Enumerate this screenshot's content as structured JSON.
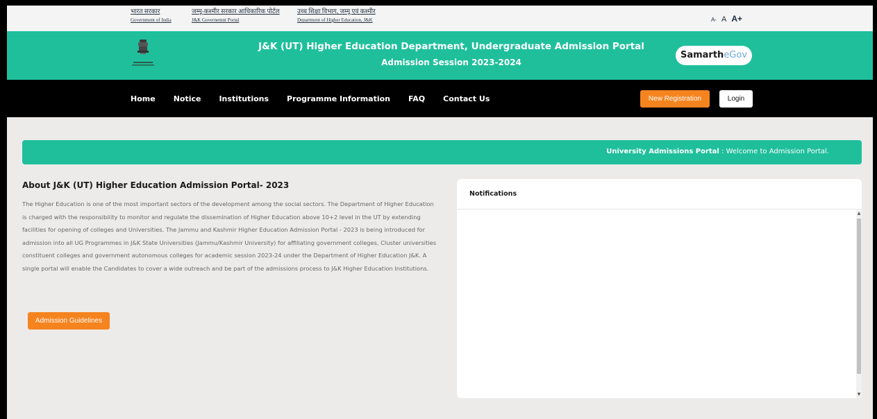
{
  "topbar": {
    "links": [
      {
        "hindi": "भारत सरकार",
        "english": "Government of India"
      },
      {
        "hindi": "जम्मू-कश्मीर सरकार आधिकारिक पोर्टल",
        "english": "J&K Governemnt Portal"
      },
      {
        "hindi": "उच्च शिक्षा विभाग, जम्मू एवं कश्मीर",
        "english": "Department of Higher Education, J&K"
      }
    ],
    "font_size": {
      "small": "A-",
      "normal": "A",
      "large": "A+"
    }
  },
  "header": {
    "title": "J&K (UT) Higher Education Department, Undergraduate Admission Portal",
    "subtitle": "Admission Session 2023-2024",
    "logo_part1": "Samarth",
    "logo_part2": "eGov"
  },
  "nav": {
    "items": [
      "Home",
      "Notice",
      "Institutions",
      "Programme Information",
      "FAQ",
      "Contact Us"
    ],
    "register_label": "New Registration",
    "login_label": "Login"
  },
  "welcome": {
    "bold": "University Admissions Portal",
    "text": " : Welcome to Admission Portal."
  },
  "about": {
    "title": "About J&K (UT) Higher Education Admission Portal- 2023",
    "body": "The Higher Education is one of the most important sectors of the development among the social sectors. The Department of Higher Education is charged with the responsibility to monitor and regulate the dissemination of Higher Education above 10+2 level in the UT by extending facilities for opening of colleges and Universities. The Jammu and Kashmir Higher Education Admission Portal - 2023 is being introduced for admission into all UG Programmes in J&K State Universities (Jammu/Kashmir University) for affiliating government colleges, Cluster universities constituent colleges and government autonomous colleges for academic session 2023-24 under the Department of Higher Education J&K. A single portal will enable the Candidates to cover a wide outreach and be part of the admissions process to J&K Higher Education Institutions.",
    "guidelines_label": "Admission Guidelines"
  },
  "notifications": {
    "title": "Notifications"
  },
  "colors": {
    "brand_green": "#1fbf9c",
    "accent_orange": "#f5841f",
    "navbar": "#000000"
  }
}
